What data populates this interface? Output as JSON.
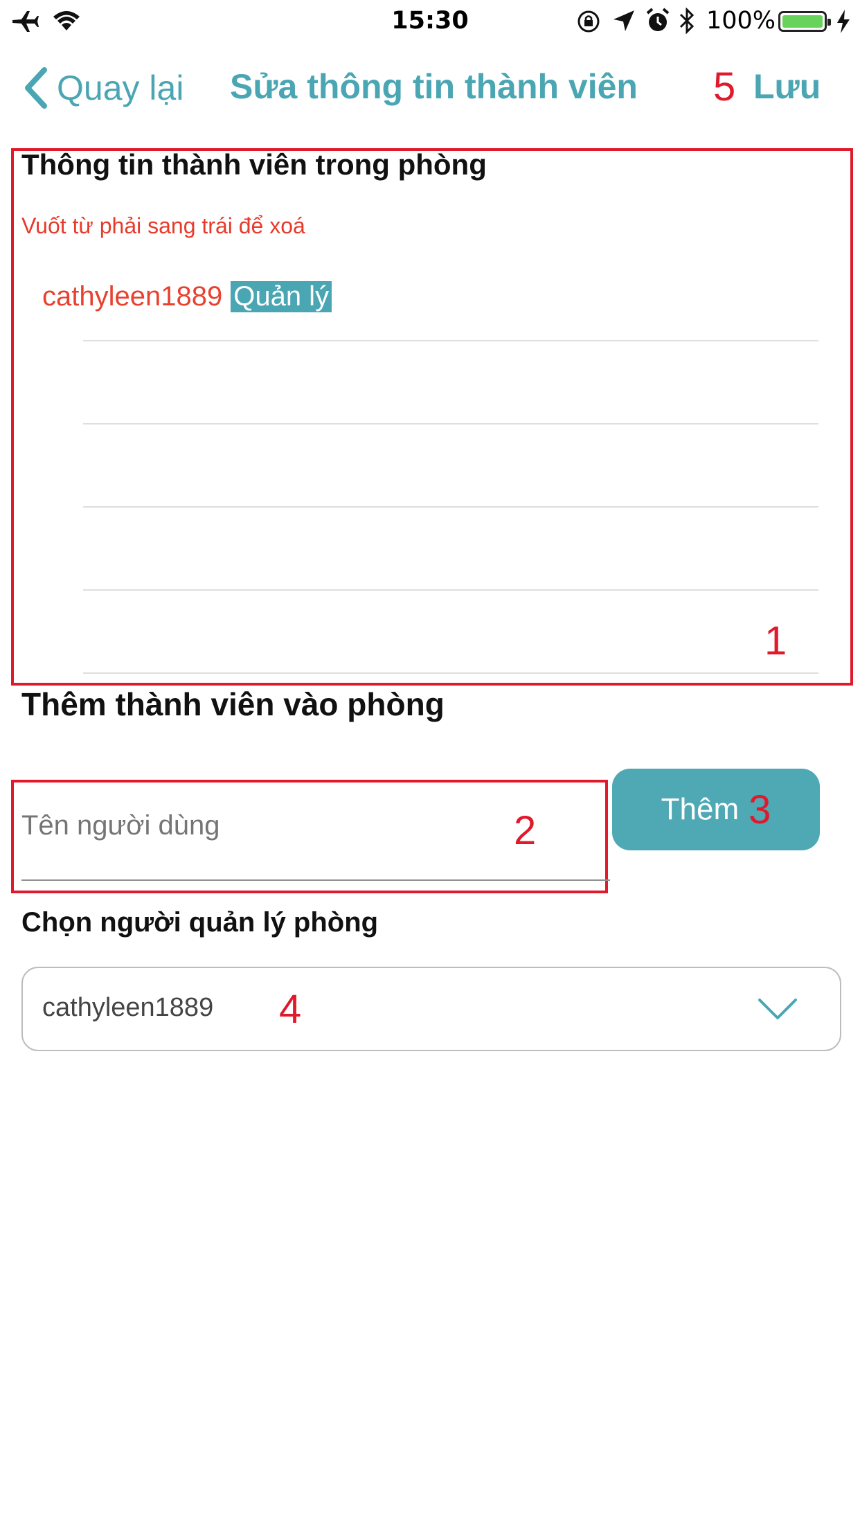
{
  "status_bar": {
    "time": "15:30",
    "battery_percent": "100%",
    "icons": [
      "airplane-icon",
      "wifi-icon",
      "orientation-lock-icon",
      "location-icon",
      "alarm-icon",
      "bluetooth-icon",
      "battery-icon",
      "charging-icon"
    ]
  },
  "nav": {
    "back_label": "Quay lại",
    "title": "Sửa thông tin thành viên",
    "save_label": "Lưu"
  },
  "members_section": {
    "title": "Thông tin thành viên trong phòng",
    "hint": "Vuốt từ phải sang trái để xoá",
    "members": [
      {
        "name": "cathyleen1889",
        "role": "Quản lý"
      }
    ]
  },
  "add_section": {
    "title": "Thêm thành viên vào phòng",
    "username_placeholder": "Tên người dùng",
    "username_value": "",
    "add_button_label": "Thêm"
  },
  "manager_section": {
    "title": "Chọn người quản lý phòng",
    "selected": "cathyleen1889"
  },
  "annotations": {
    "a1": "1",
    "a2": "2",
    "a3": "3",
    "a4": "4",
    "a5": "5"
  },
  "colors": {
    "accent": "#4aa6b3",
    "annotation_red": "#e0192b",
    "hint_red": "#e83a2b"
  }
}
